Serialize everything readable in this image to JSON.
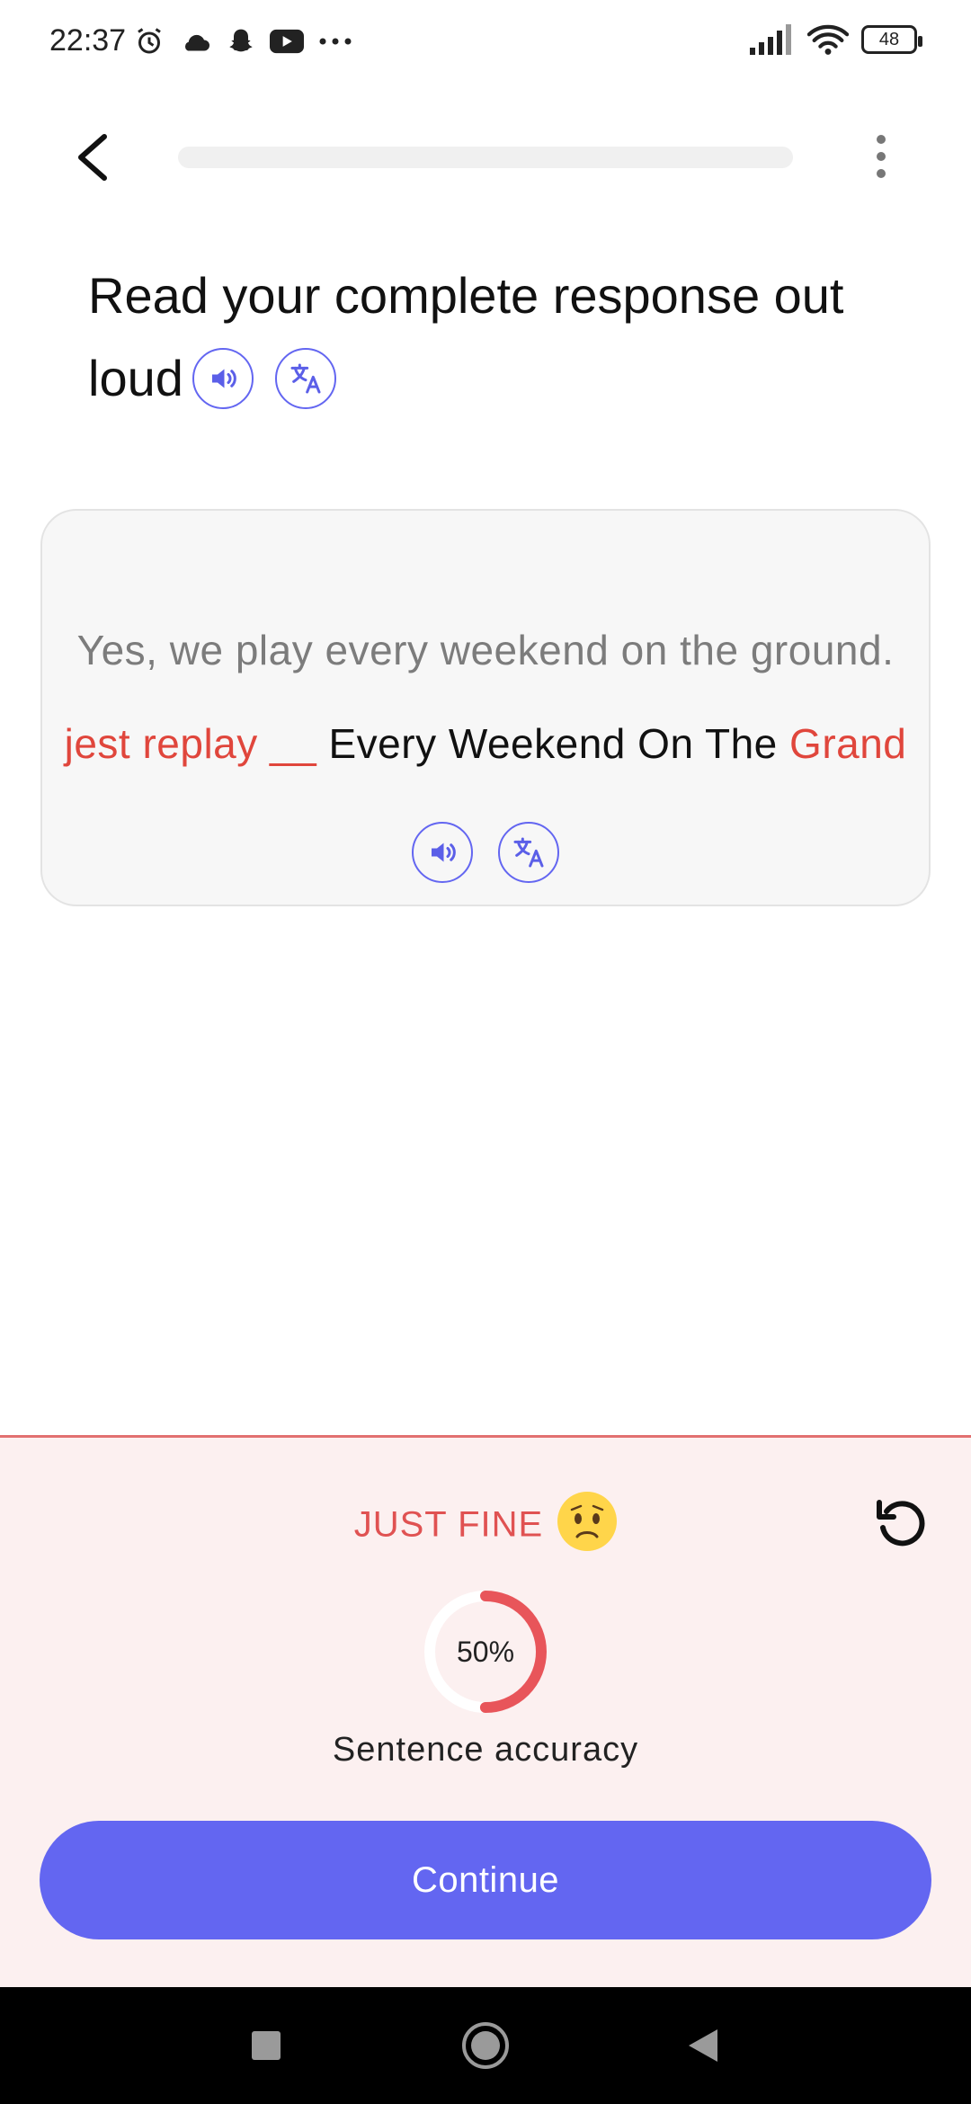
{
  "status_bar": {
    "time": "22:37",
    "battery": "48",
    "left_icons": [
      "alarm-icon",
      "cloud-icon",
      "snapchat-icon",
      "youtube-icon",
      "more-dots-icon"
    ],
    "right_icons": [
      "signal-icon",
      "wifi-icon",
      "battery-icon"
    ]
  },
  "header": {
    "progress": 0.0
  },
  "prompt": {
    "title": "Read your complete response out loud"
  },
  "card": {
    "target_sentence": "Yes, we play every weekend on the ground.",
    "recognized": {
      "w1": "jest",
      "w2": "replay",
      "w3": "__",
      "w4": "Every",
      "w5": "Weekend",
      "w6": "On",
      "w7": "The",
      "w8": "Grand"
    }
  },
  "result": {
    "label": "JUST FINE",
    "accuracy_value": 0.5,
    "accuracy_text": "50%",
    "accuracy_label": "Sentence accuracy",
    "continue_label": "Continue"
  },
  "colors": {
    "accent": "#6366f1",
    "error": "#e0463c",
    "panel_bg": "#fcf0f0"
  }
}
